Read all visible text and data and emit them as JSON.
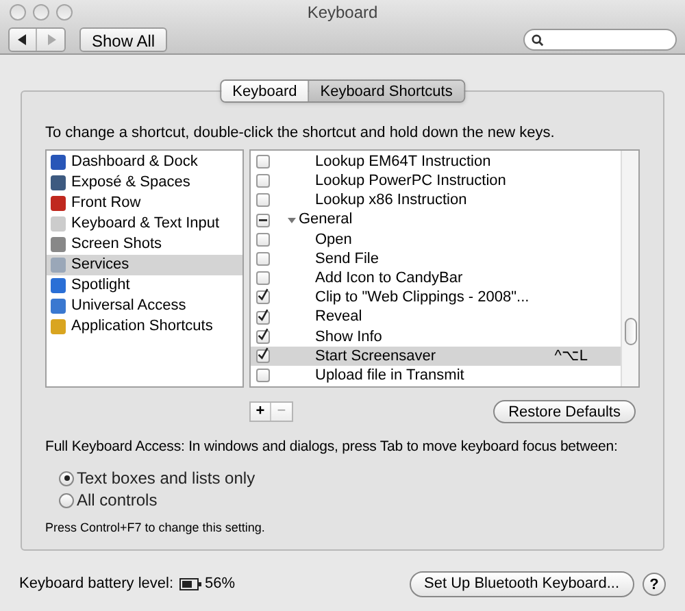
{
  "window": {
    "title": "Keyboard"
  },
  "toolbar": {
    "show_all": "Show All"
  },
  "tabs": [
    {
      "label": "Keyboard",
      "selected": false
    },
    {
      "label": "Keyboard Shortcuts",
      "selected": true
    }
  ],
  "instruction": "To change a shortcut, double-click the shortcut and hold down the new keys.",
  "categories": [
    {
      "label": "Dashboard & Dock",
      "selected": false
    },
    {
      "label": "Exposé & Spaces",
      "selected": false
    },
    {
      "label": "Front Row",
      "selected": false
    },
    {
      "label": "Keyboard & Text Input",
      "selected": false
    },
    {
      "label": "Screen Shots",
      "selected": false
    },
    {
      "label": "Services",
      "selected": true
    },
    {
      "label": "Spotlight",
      "selected": false
    },
    {
      "label": "Universal Access",
      "selected": false
    },
    {
      "label": "Application Shortcuts",
      "selected": false
    }
  ],
  "shortcuts": [
    {
      "kind": "item",
      "label": "Lookup EM64T Instruction",
      "checked": false,
      "selected": false
    },
    {
      "kind": "item",
      "label": "Lookup PowerPC Instruction",
      "checked": false,
      "selected": false
    },
    {
      "kind": "item",
      "label": "Lookup x86 Instruction",
      "checked": false,
      "selected": false
    },
    {
      "kind": "group",
      "label": "General",
      "expanded": true,
      "mixed": true
    },
    {
      "kind": "item",
      "label": "Open",
      "checked": false,
      "selected": false
    },
    {
      "kind": "item",
      "label": "Send File",
      "checked": false,
      "selected": false
    },
    {
      "kind": "item",
      "label": "Add Icon to CandyBar",
      "checked": false,
      "selected": false
    },
    {
      "kind": "item",
      "label": "Clip to \"Web Clippings - 2008\"...",
      "checked": true,
      "selected": false
    },
    {
      "kind": "item",
      "label": "Reveal",
      "checked": true,
      "selected": false
    },
    {
      "kind": "item",
      "label": "Show Info",
      "checked": true,
      "selected": false
    },
    {
      "kind": "item",
      "label": "Start Screensaver",
      "checked": true,
      "selected": true,
      "shortcut": "^⌥L"
    },
    {
      "kind": "item",
      "label": "Upload file in Transmit",
      "checked": false,
      "selected": false
    }
  ],
  "add_button": "+",
  "remove_button": "−",
  "restore_button": "Restore Defaults",
  "full_keyboard_access": {
    "label": "Full Keyboard Access: In windows and dialogs, press Tab to move keyboard focus between:",
    "options": [
      {
        "label": "Text boxes and lists only",
        "selected": true
      },
      {
        "label": "All controls",
        "selected": false
      }
    ],
    "hint": "Press Control+F7 to change this setting."
  },
  "battery": {
    "label": "Keyboard battery level:",
    "reading": "56%"
  },
  "bluetooth_button": "Set Up Bluetooth Keyboard...",
  "help_button": "?"
}
